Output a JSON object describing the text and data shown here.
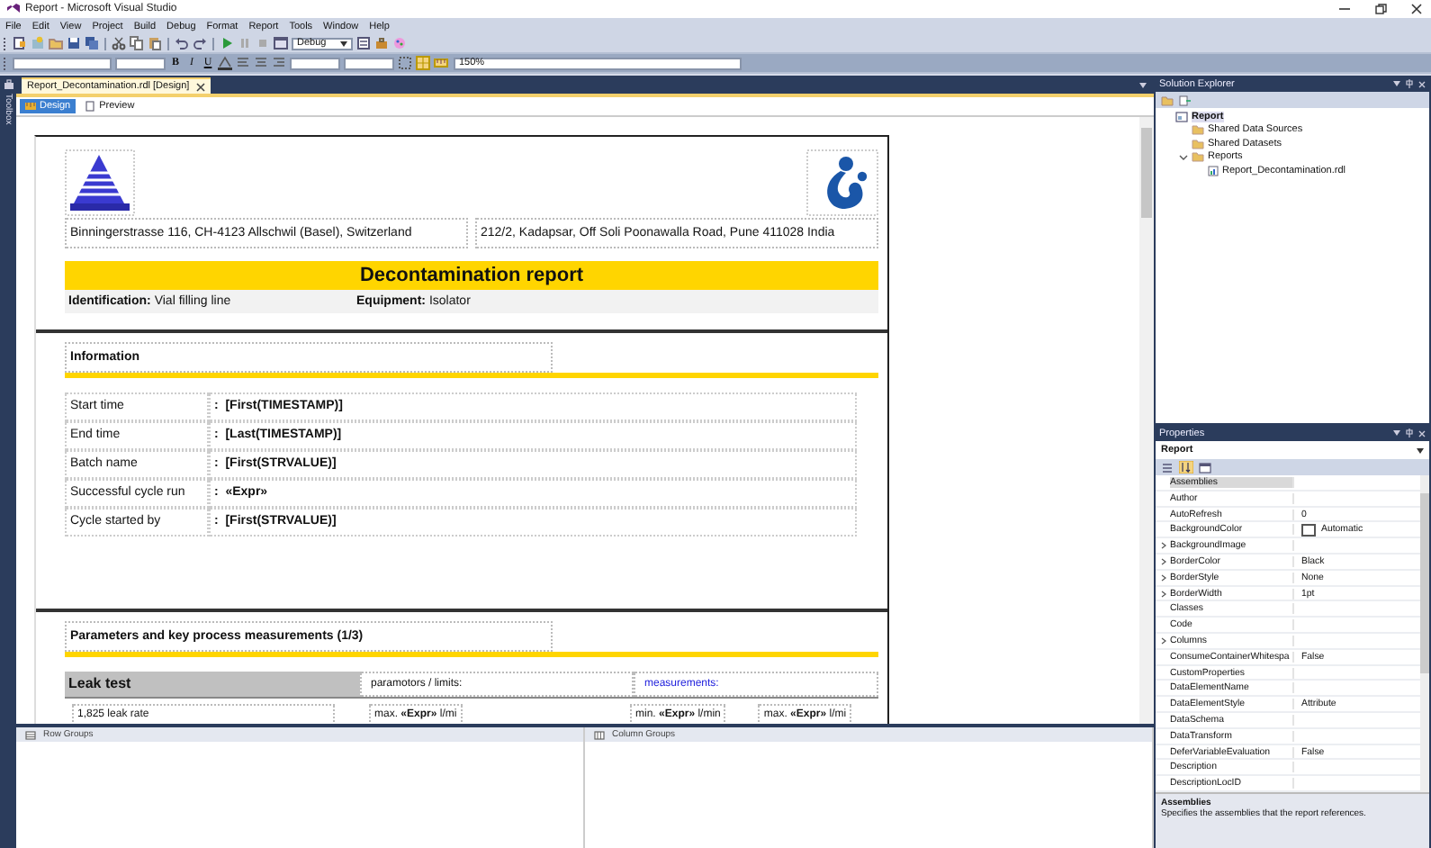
{
  "window": {
    "title": "Report - Microsoft Visual Studio"
  },
  "menu": [
    "File",
    "Edit",
    "View",
    "Project",
    "Build",
    "Debug",
    "Format",
    "Report",
    "Tools",
    "Window",
    "Help"
  ],
  "toolbar": {
    "configuration": "Debug",
    "zoom": "150%"
  },
  "format_buttons": [
    "B",
    "I",
    "U"
  ],
  "toolbox": {
    "label": "Toolbox"
  },
  "document_tab": {
    "title": "Report_Decontamination.rdl [Design]"
  },
  "view_tabs": [
    {
      "label": "Design",
      "selected": true
    },
    {
      "label": "Preview",
      "selected": false
    }
  ],
  "report": {
    "addresses": [
      "Binningerstrasse 116, CH-4123 Allschwil (Basel), Switzerland",
      "212/2, Kadapsar, Off Soli Poonawalla Road, Pune 411028 India"
    ],
    "title": "Decontamination report",
    "details": [
      "**Identification:** Vial filling line",
      "**Equipment:** Isolator"
    ],
    "information_heading": "Information",
    "information_rows": [
      {
        "label": "Start time",
        "value": ":  [First(TIMESTAMP)]"
      },
      {
        "label": "End time",
        "value": ":  [Last(TIMESTAMP)]"
      },
      {
        "label": "Batch name",
        "value": ":  [First(STRVALUE)]"
      },
      {
        "label": "Successful cycle run",
        "value": ":  «Expr»"
      },
      {
        "label": "Cycle started by",
        "value": ":  [First(STRVALUE)]"
      }
    ],
    "parameters_heading": "Parameters and key process measurements (1/3)",
    "leak_test": {
      "header": "Leak test",
      "parameters_header": "paramotors / limits:",
      "measurements_header": "measurements:",
      "items": [
        "1,825 leak rate"
      ],
      "parameter_cells": [
        "max. **«Expr»** l/mi"
      ],
      "measurement_cells": [
        "min. **«Expr»** l/min",
        "max. **«Expr»** l/mi"
      ]
    }
  },
  "bottom_panels": [
    {
      "title": "Row Groups"
    },
    {
      "title": "Column Groups"
    }
  ],
  "solution_explorer": {
    "title": "Solution Explorer",
    "tree": [
      {
        "label": "Report",
        "kind": "project",
        "selected": true,
        "children": [
          {
            "label": "Shared Data Sources",
            "kind": "folder",
            "selected": false
          },
          {
            "label": "Shared Datasets",
            "kind": "folder",
            "selected": false
          },
          {
            "label": "Reports",
            "kind": "folder",
            "selected": false,
            "expanded": true,
            "children": [
              {
                "label": "Report_Decontamination.rdl",
                "kind": "file",
                "selected": false
              }
            ]
          }
        ]
      }
    ]
  },
  "properties": {
    "title": "Properties",
    "object": "Report",
    "rows": [
      {
        "name": "Assemblies",
        "value": "",
        "kind": "text",
        "expandable": false,
        "selected": true
      },
      {
        "name": "Author",
        "kind": "text",
        "expandable": false,
        "selected": false
      },
      {
        "name": "AutoRefresh",
        "value": "0",
        "kind": "text",
        "expandable": false,
        "selected": false
      },
      {
        "name": "BackgroundColor",
        "value": "Automatic",
        "kind": "color",
        "expandable": false,
        "selected": false
      },
      {
        "name": "BackgroundImage",
        "kind": "text",
        "expandable": true,
        "selected": false
      },
      {
        "name": "BorderColor",
        "value": "Black",
        "kind": "text",
        "expandable": true,
        "selected": false
      },
      {
        "name": "BorderStyle",
        "value": "None",
        "kind": "text",
        "expandable": true,
        "selected": false
      },
      {
        "name": "BorderWidth",
        "value": "1pt",
        "kind": "text",
        "expandable": true,
        "selected": false
      },
      {
        "name": "Classes",
        "kind": "text",
        "expandable": false,
        "selected": false
      },
      {
        "name": "Code",
        "kind": "text",
        "expandable": false,
        "selected": false
      },
      {
        "name": "Columns",
        "kind": "text",
        "expandable": true,
        "selected": false
      },
      {
        "name": "ConsumeContainerWhitespa",
        "value": "False",
        "kind": "text",
        "expandable": false,
        "selected": false
      },
      {
        "name": "CustomProperties",
        "kind": "text",
        "expandable": false,
        "selected": false
      },
      {
        "name": "DataElementName",
        "kind": "text",
        "expandable": false,
        "selected": false
      },
      {
        "name": "DataElementStyle",
        "value": "Attribute",
        "kind": "text",
        "expandable": false,
        "selected": false
      },
      {
        "name": "DataSchema",
        "kind": "text",
        "expandable": false,
        "selected": false
      },
      {
        "name": "DataTransform",
        "kind": "text",
        "expandable": false,
        "selected": false
      },
      {
        "name": "DeferVariableEvaluation",
        "value": "False",
        "kind": "text",
        "expandable": false,
        "selected": false
      },
      {
        "name": "Description",
        "kind": "text",
        "expandable": false,
        "selected": false
      },
      {
        "name": "DescriptionLocID",
        "kind": "text",
        "expandable": false,
        "selected": false
      }
    ],
    "help_title": "Assemblies",
    "help_text": "Specifies the assemblies that the report references."
  }
}
